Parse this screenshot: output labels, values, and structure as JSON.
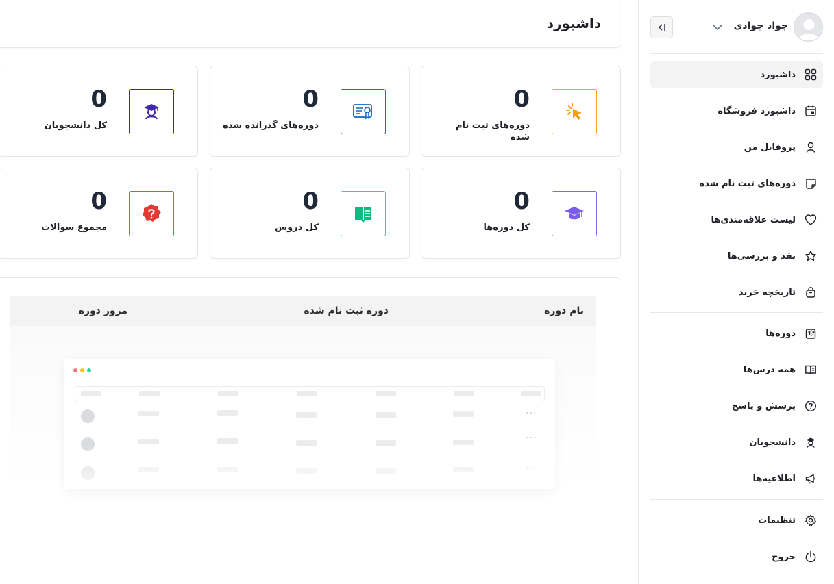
{
  "header": {
    "title": "داشبورد"
  },
  "user": {
    "name": "جواد جوادی"
  },
  "sidebar": {
    "items": [
      {
        "label": "داشبورد",
        "icon": "grid-icon",
        "active": true
      },
      {
        "label": "داشبورد فروشگاه",
        "icon": "calendar-store-icon"
      },
      {
        "label": "پروفایل من",
        "icon": "user-icon"
      },
      {
        "label": "دوره‌های ثبت نام شده",
        "icon": "enrolled-icon"
      },
      {
        "label": "لیست علاقه‌مندی‌ها",
        "icon": "heart-icon"
      },
      {
        "label": "نقد و بررسی‌ها",
        "icon": "star-icon"
      },
      {
        "label": "تاریخچه خرید",
        "icon": "bag-icon"
      },
      {
        "label": "دوره‌ها",
        "icon": "courses-icon"
      },
      {
        "label": "همه درس‌ها",
        "icon": "book-icon"
      },
      {
        "label": "پرسش و پاسخ",
        "icon": "question-icon"
      },
      {
        "label": "دانشجویان",
        "icon": "student-icon"
      },
      {
        "label": "اطلاعیه‌ها",
        "icon": "megaphone-icon"
      },
      {
        "label": "تنظیمات",
        "icon": "gear-icon"
      },
      {
        "label": "خروج",
        "icon": "power-icon"
      }
    ]
  },
  "stats": [
    {
      "value": "0",
      "label": "دوره‌های ثبت نام شده",
      "icon": "cursor-click-icon",
      "color": "#f59e0b"
    },
    {
      "value": "0",
      "label": "دوره‌های گذرانده شده",
      "icon": "certificate-icon",
      "color": "#1565c0"
    },
    {
      "value": "0",
      "label": "کل دانشجویان",
      "icon": "student-icon",
      "color": "#3f2aa8"
    },
    {
      "value": "0",
      "label": "کل دوره‌ها",
      "icon": "graduation-cap-icon",
      "color": "#7c5cf0"
    },
    {
      "value": "0",
      "label": "کل دروس",
      "icon": "open-book-icon",
      "color": "#10b981"
    },
    {
      "value": "0",
      "label": "مجموع سوالات",
      "icon": "question-badge-icon",
      "color": "#e53935"
    }
  ],
  "table": {
    "columns": [
      "نام دوره",
      "دوره ثبت نام شده",
      "مرور دوره"
    ]
  }
}
